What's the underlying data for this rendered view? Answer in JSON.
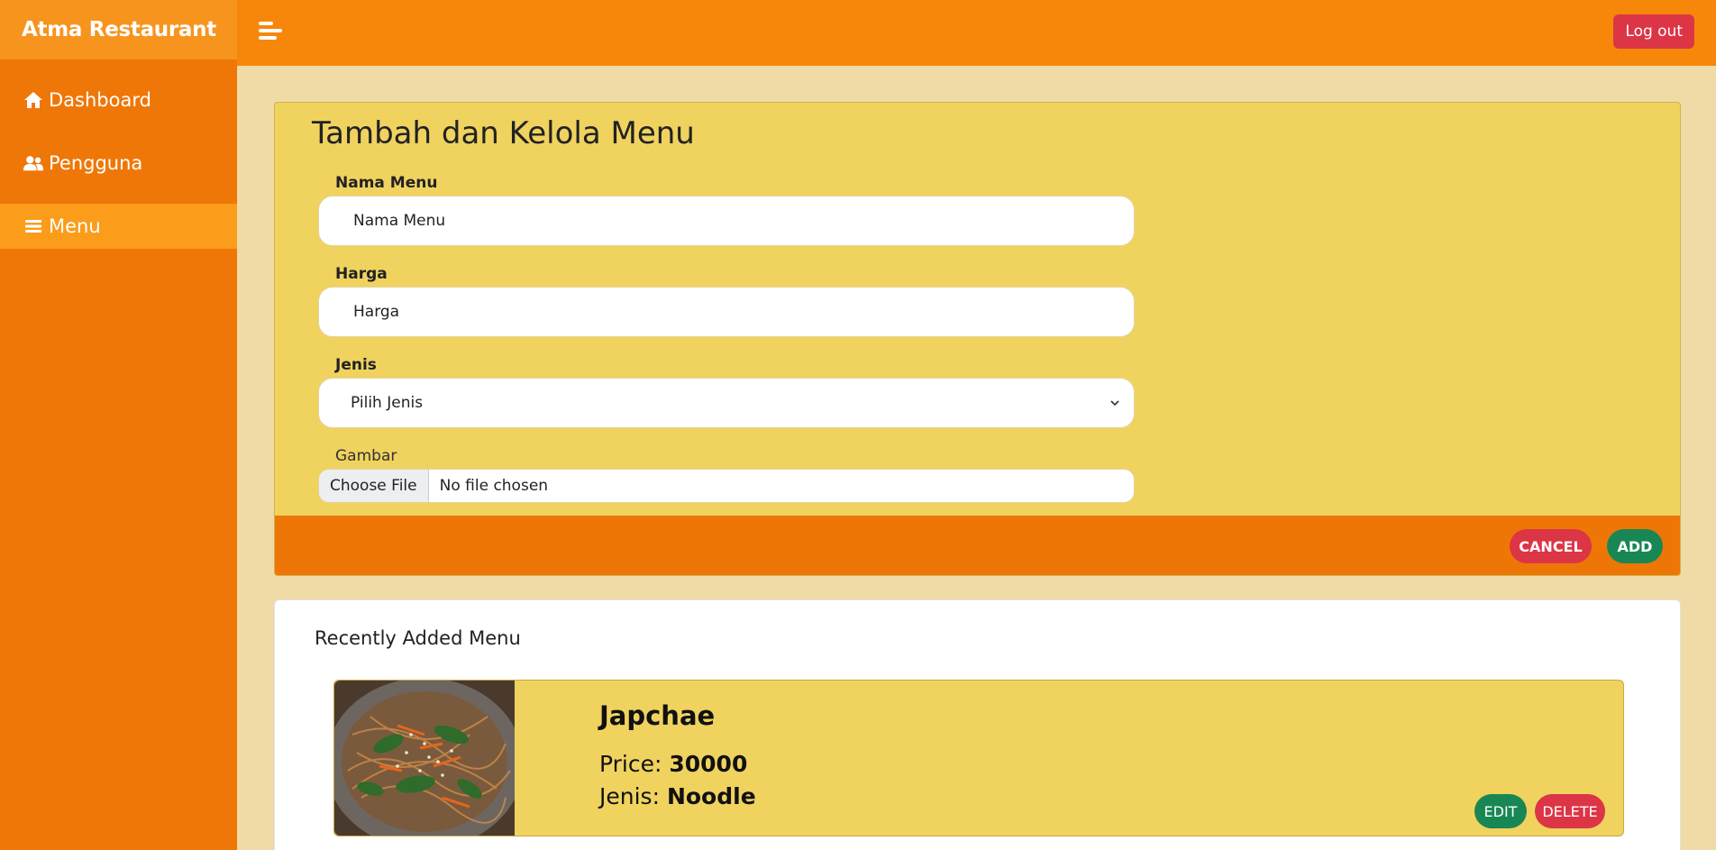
{
  "app": {
    "brand": "Atma Restaurant"
  },
  "sidebar": {
    "items": [
      {
        "label": "Dashboard",
        "icon": "home-icon"
      },
      {
        "label": "Pengguna",
        "icon": "users-icon"
      },
      {
        "label": "Menu",
        "icon": "menu-list-icon",
        "active": true
      }
    ]
  },
  "header": {
    "logout_label": "Log out"
  },
  "form": {
    "title": "Tambah dan Kelola Menu",
    "nama_label": "Nama Menu",
    "nama_placeholder": "Nama Menu",
    "harga_label": "Harga",
    "harga_placeholder": "Harga",
    "jenis_label": "Jenis",
    "jenis_selected": "Pilih Jenis",
    "gambar_label": "Gambar",
    "file_button": "Choose File",
    "file_status": "No file chosen",
    "cancel_label": "CANCEL",
    "add_label": "ADD"
  },
  "recent": {
    "title": "Recently Added Menu",
    "items": [
      {
        "name": "Japchae",
        "price_label": "Price: ",
        "price": "30000",
        "jenis_label": "Jenis: ",
        "jenis": "Noodle",
        "edit_label": "EDIT",
        "delete_label": "DELETE"
      }
    ]
  },
  "colors": {
    "sidebar": "#ef7707",
    "header": "#f7870b",
    "card": "#f0d25f",
    "danger": "#dc3545",
    "success": "#198754"
  }
}
